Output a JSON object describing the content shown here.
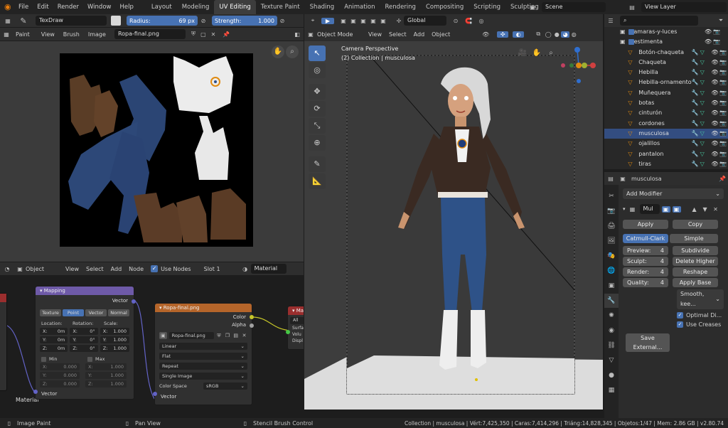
{
  "topbar": {
    "menus": [
      "File",
      "Edit",
      "Render",
      "Window",
      "Help"
    ],
    "workspaces": [
      "Layout",
      "Modeling",
      "UV Editing",
      "Texture Paint",
      "Shading",
      "Animation",
      "Rendering",
      "Compositing",
      "Scripting",
      "Sculpting"
    ],
    "active_workspace": "UV Editing",
    "add_tab": "+",
    "scene": "Scene",
    "view_layer": "View Layer"
  },
  "tool_settings": {
    "brush": "TexDraw",
    "radius_label": "Radius:",
    "radius_value": "69 px",
    "strength_label": "Strength:",
    "strength_value": "1.000"
  },
  "image_editor": {
    "mode": "Paint",
    "menus": [
      "View",
      "Brush",
      "Image"
    ],
    "image_name": "Ropa-final.png"
  },
  "viewport": {
    "mode": "Object Mode",
    "menus": [
      "View",
      "Select",
      "Add",
      "Object"
    ],
    "orientation": "Global",
    "camera_label": "Camera Perspective",
    "collection_label": "(2) Collection | musculosa"
  },
  "node_editor": {
    "type": "Object",
    "menus": [
      "View",
      "Select",
      "Add",
      "Node"
    ],
    "use_nodes_label": "Use Nodes",
    "slot": "Slot 1",
    "material": "Material",
    "mapping": {
      "title": "Mapping",
      "output": "Vector",
      "types": [
        "Texture",
        "Point",
        "Vector",
        "Normal"
      ],
      "active_type": "Point",
      "location_label": "Location:",
      "rotation_label": "Rotation:",
      "scale_label": "Scale:",
      "rows": [
        {
          "axis": "X:",
          "loc": "0m",
          "rot": "0°",
          "scale": "1.000"
        },
        {
          "axis": "Y:",
          "loc": "0m",
          "rot": "0°",
          "scale": "1.000"
        },
        {
          "axis": "Z:",
          "loc": "0m",
          "rot": "0°",
          "scale": "1.000"
        }
      ],
      "min_label": "Min",
      "max_label": "Max",
      "min_rows": [
        {
          "axis": "X:",
          "v": "0.000"
        },
        {
          "axis": "Y:",
          "v": "0.000"
        },
        {
          "axis": "Z:",
          "v": "0.000"
        }
      ],
      "max_rows": [
        {
          "axis": "X:",
          "v": "1.000"
        },
        {
          "axis": "Y:",
          "v": "1.000"
        },
        {
          "axis": "Z:",
          "v": "1.000"
        }
      ],
      "input": "Vector"
    },
    "image_node": {
      "title": "Ropa-final.png",
      "outputs": [
        "Color",
        "Alpha"
      ],
      "image": "Ropa-final.png",
      "interpolation": "Linear",
      "projection": "Flat",
      "extension": "Repeat",
      "source": "Single Image",
      "color_space_label": "Color Space",
      "color_space": "sRGB",
      "input": "Vector"
    },
    "material_node": {
      "title": "Mat",
      "all": "All",
      "sockets": [
        "Surfa",
        "Volu",
        "Displ"
      ]
    },
    "material_output_label": "Material"
  },
  "outliner": {
    "items": [
      {
        "name": "camaras-y-luces",
        "indent": 1,
        "sel": false
      },
      {
        "name": "vestimenta",
        "indent": 1,
        "sel": false
      },
      {
        "name": "Botón-chaqueta",
        "indent": 2,
        "sel": false
      },
      {
        "name": "Chaqueta",
        "indent": 2,
        "sel": false
      },
      {
        "name": "Hebilla",
        "indent": 2,
        "sel": false
      },
      {
        "name": "Hebilla-ornamento",
        "indent": 2,
        "sel": false
      },
      {
        "name": "Muñequera",
        "indent": 2,
        "sel": false
      },
      {
        "name": "botas",
        "indent": 2,
        "sel": false
      },
      {
        "name": "cinturón",
        "indent": 2,
        "sel": false
      },
      {
        "name": "cordones",
        "indent": 2,
        "sel": false
      },
      {
        "name": "musculosa",
        "indent": 2,
        "sel": true
      },
      {
        "name": "ojalillos",
        "indent": 2,
        "sel": false
      },
      {
        "name": "pantalon",
        "indent": 2,
        "sel": false
      },
      {
        "name": "tiras",
        "indent": 2,
        "sel": false
      }
    ]
  },
  "properties": {
    "object_name": "musculosa",
    "add_modifier": "Add Modifier",
    "modifier_name": "Mul",
    "apply": "Apply",
    "copy": "Copy",
    "catmull": "Catmull-Clark",
    "simple": "Simple",
    "preview_label": "Preview:",
    "preview_value": "4",
    "sculpt_label": "Sculpt:",
    "sculpt_value": "4",
    "render_label": "Render:",
    "render_value": "4",
    "quality_label": "Quality:",
    "quality_value": "4",
    "subdivide": "Subdivide",
    "delete_higher": "Delete Higher",
    "reshape": "Reshape",
    "apply_base": "Apply Base",
    "smooth": "Smooth, kee...",
    "optimal": "Optimal Di...",
    "use_creases": "Use Creases",
    "save_external": "Save External..."
  },
  "status": {
    "left": "Image Paint",
    "middle": "Pan View",
    "right": "Stencil Brush Control",
    "stats": "Collection | musculosa | Vért:7,425,350 | Caras:7,414,296 | Triáng:14,828,345 | Objetos:1/47 | Mem: 2.86 GB | v2.80.74"
  },
  "colors": {
    "accent": "#4772b3",
    "mapping_header": "#6e5aa8",
    "image_header": "#b5652a",
    "material_header": "#9a2e2e",
    "selected_row": "#334d80"
  }
}
